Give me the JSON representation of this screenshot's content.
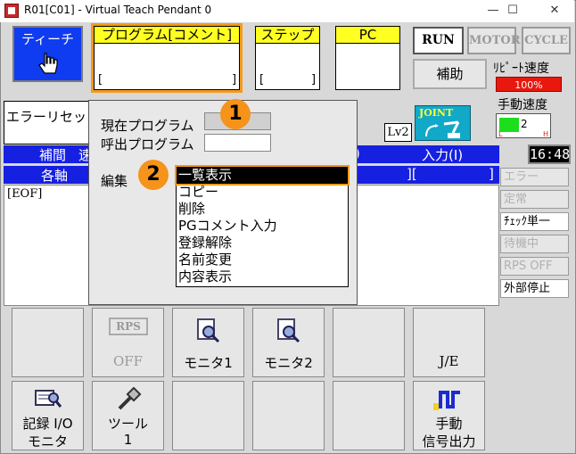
{
  "window": {
    "title": "R01[C01] - Virtual Teach Pendant 0",
    "min": "—",
    "max": "☐",
    "close": "✕"
  },
  "header": {
    "teach_label": "ティーチ",
    "program_label": "プログラム[コメント]",
    "program_bracket": "[",
    "program_bracket_close": "]",
    "step_label": "ステップ",
    "step_bracket": "[",
    "step_bracket_close": "]",
    "pc_label": "PC",
    "run_label": "RUN",
    "motor_label": "MOTOR",
    "cycle_label": "CYCLE",
    "hojo_label": "補助",
    "repeat_speed_label": "ﾘﾋﾟｰﾄ速度",
    "repeat_speed_value": "100%",
    "manual_speed_label": "手動速度",
    "manual_speed_value": "2",
    "manual_speed_l": "L",
    "manual_speed_h": "H",
    "joint_label": "JOINT",
    "lv_label": "Lv2",
    "time": "16:48"
  },
  "status": {
    "error_reset": "エラーリセッ",
    "hokan_label": "補間",
    "speed_partial": "速",
    "axes_label": "各軸",
    "input_label": "入力(I)",
    "input_partial": ")",
    "input_bracket": "][",
    "input_bracket_close": "]",
    "eof": "[EOF]"
  },
  "side_buttons": [
    "エラー",
    "定常",
    "ﾁｪｯｸ単一",
    "待機中",
    "RPS OFF",
    "外部停止"
  ],
  "dialog": {
    "current_program_label": "現在プログラム",
    "call_program_label": "呼出プログラム",
    "edit_label": "編集",
    "badge1": "1",
    "badge2": "2",
    "menu_items": [
      "一覧表示",
      "コピー",
      "削除",
      "PGコメント入力",
      "登録解除",
      "名前変更",
      "内容表示"
    ]
  },
  "function_keys": {
    "rps": "RPS",
    "rps_off": "OFF",
    "monitor1": "モニタ1",
    "monitor2": "モニタ2",
    "je": "J/E",
    "record_io_1": "記録 I/O",
    "record_io_2": "モニタ",
    "tool_1": "ツール",
    "tool_2": "1",
    "manual_signal_1": "手動",
    "manual_signal_2": "信号出力"
  },
  "colors": {
    "teach_blue": "#0f3cf0",
    "header_yellow": "#ffff22",
    "accent_orange": "#f49a1a",
    "status_blue": "#1620e0",
    "speed_red": "#e8180e"
  }
}
